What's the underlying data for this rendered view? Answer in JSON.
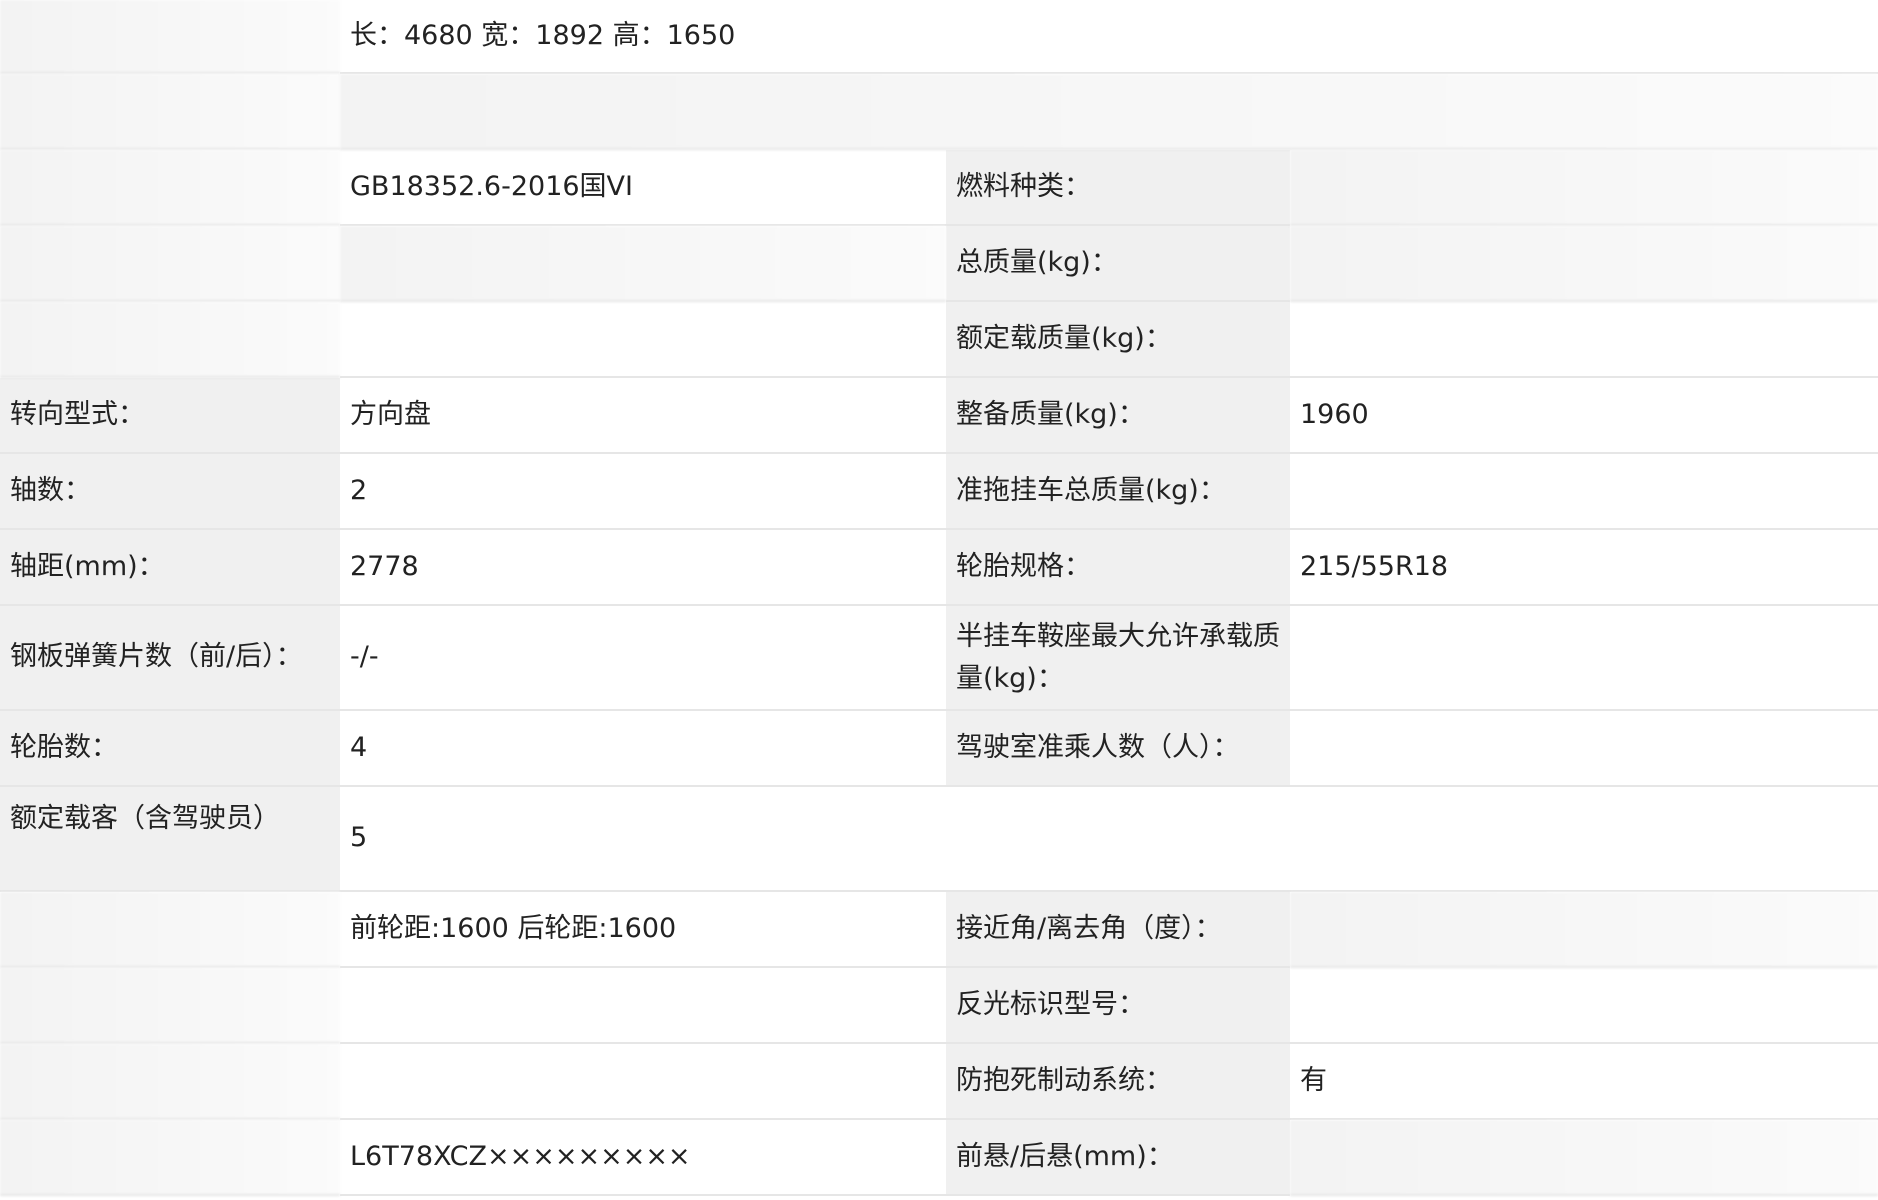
{
  "rows": [
    {
      "label1": "",
      "value1": "长：4680 宽：1892 高：1650",
      "span": true
    },
    {
      "label1": "",
      "value1": "",
      "span": true
    },
    {
      "label1": "",
      "value1": "GB18352.6-2016国VI",
      "label2": "燃料种类：",
      "value2": ""
    },
    {
      "label1": "",
      "value1": "",
      "label2": "总质量(kg)：",
      "value2": ""
    },
    {
      "label1": "",
      "value1": "",
      "label2": "额定载质量(kg)：",
      "value2": ""
    },
    {
      "label1": "转向型式：",
      "value1": "方向盘",
      "label2": "整备质量(kg)：",
      "value2": "1960"
    },
    {
      "label1": "轴数：",
      "value1": "2",
      "label2": "准拖挂车总质量(kg)：",
      "value2": ""
    },
    {
      "label1": "轴距(mm)：",
      "value1": "2778",
      "label2": "轮胎规格：",
      "value2": "215/55R18"
    },
    {
      "label1": "钢板弹簧片数（前/后）：",
      "value1": "-/-",
      "label2": "半挂车鞍座最大允许承载质量(kg)：",
      "value2": ""
    },
    {
      "label1": "轮胎数：",
      "value1": "4",
      "label2": "驾驶室准乘人数（人）：",
      "value2": ""
    },
    {
      "label1": "额定载客（含驾驶员）",
      "value1": "5",
      "span": true
    },
    {
      "label1": "",
      "value1": "前轮距:1600 后轮距:1600",
      "label2": "接近角/离去角（度）：",
      "value2": ""
    },
    {
      "label1": "",
      "value1": "",
      "label2": "反光标识型号：",
      "value2": ""
    },
    {
      "label1": "",
      "value1": "",
      "label2": "防抱死制动系统：",
      "value2": "有"
    },
    {
      "label1": "",
      "value1": "L6T78XCZ×××××××××",
      "label2": "前悬/后悬(mm)：",
      "value2": ""
    }
  ]
}
